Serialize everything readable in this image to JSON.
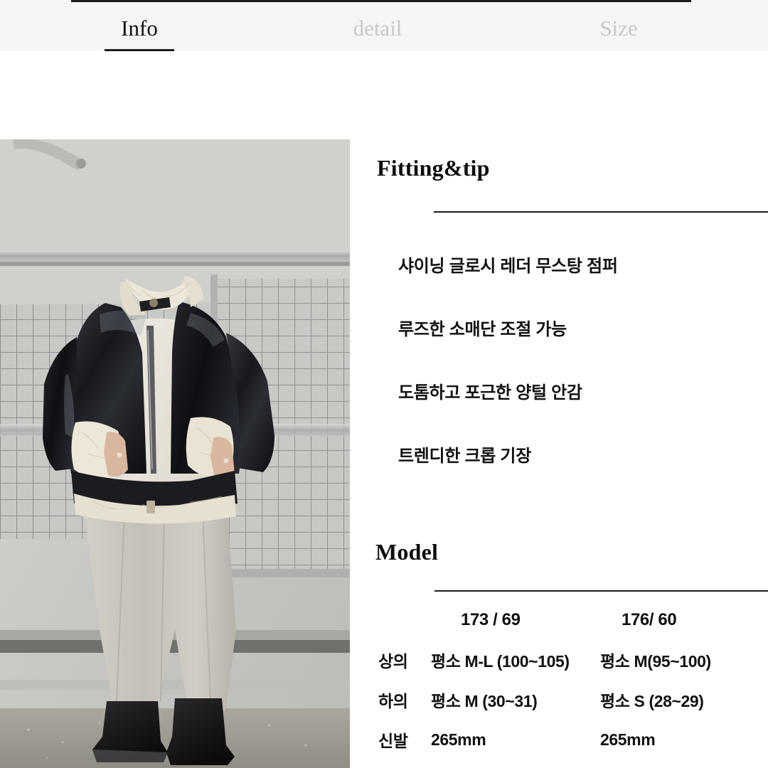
{
  "tabs": [
    {
      "label": "Info",
      "active": true
    },
    {
      "label": "detail",
      "active": false
    },
    {
      "label": "Size",
      "active": false
    }
  ],
  "sections": {
    "fitting": {
      "title": "Fitting&tip",
      "bullets": [
        "샤이닝 글로시 레더 무스탕 점퍼",
        "루즈한 소매단 조절 가능",
        "도톰하고 포근한 양털 안감",
        "트렌디한 크롭 기장"
      ]
    },
    "model": {
      "title": "Model",
      "header": {
        "label": "",
        "model_a": "173 / 69",
        "model_b": "176/ 60"
      },
      "rows": [
        {
          "label": "상의",
          "model_a": "평소 M-L (100~105)",
          "model_b": "평소 M(95~100)"
        },
        {
          "label": "하의",
          "model_a": "평소 M (30~31)",
          "model_b": "평소 S (28~29)"
        },
        {
          "label": "신발",
          "model_a": "265mm",
          "model_b": "265mm"
        }
      ]
    }
  },
  "photo": {
    "alt": "model wearing black glossy leather shearling bomber jacket with white tee and light gray wide leg pants, black chunky boots, leaning on metal railing"
  },
  "colors": {
    "tabbar_bg": "#f5f5f5",
    "active_tab": "#111111",
    "inactive_tab": "#c9c9c9",
    "rule": "#1c1c1c",
    "text": "#121212"
  }
}
